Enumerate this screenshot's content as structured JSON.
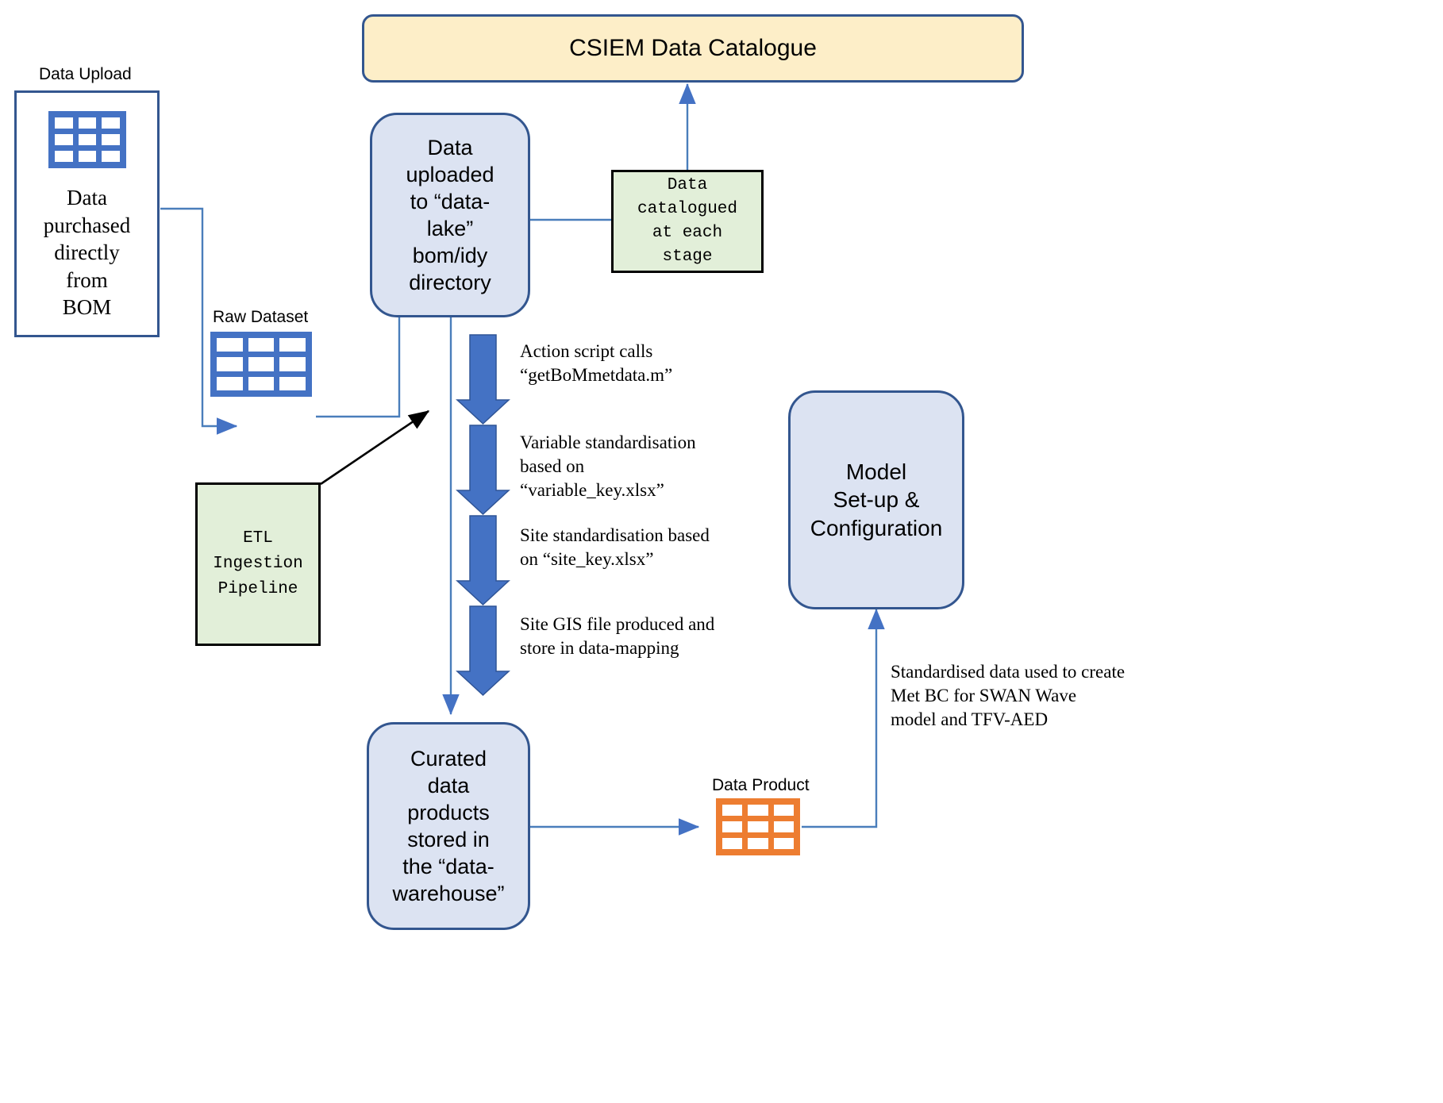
{
  "diagram": {
    "title_banner": {
      "label": "CSIEM Data Catalogue"
    },
    "nodes": {
      "data_upload_caption": "Data Upload",
      "data_upload_body": "Data\npurchased\ndirectly\nfrom\nBOM",
      "raw_dataset_caption": "Raw Dataset",
      "data_lake": "Data\nuploaded\nto “data-\nlake”\nbom/idy\ndirectory",
      "data_catalogued": "Data\ncatalogued\nat each\nstage",
      "etl_pipeline": "ETL\nIngestion\nPipeline",
      "model_setup": "Model\nSet-up &\nConfiguration",
      "curated_products": "Curated\ndata\nproducts\nstored in\nthe “data-\nwarehouse”",
      "data_product_caption": "Data Product"
    },
    "step_labels": [
      "Action script calls\n“getBoMmetdata.m”",
      "Variable standardisation\nbased on\n“variable_key.xlsx”",
      "Site standardisation based\non “site_key.xlsx”",
      "Site GIS file produced and\nstore in data-mapping"
    ],
    "annotations": {
      "model_input": "Standardised data used to create\nMet BC for SWAN Wave\nmodel and TFV-AED"
    },
    "colors": {
      "process_fill": "#dce3f2",
      "process_stroke": "#33568f",
      "banner_fill": "#fdeec8",
      "green_fill": "#e2efd9",
      "green_stroke": "#000000",
      "table_blue": "#4472c4",
      "table_orange": "#ed7d31",
      "arrow_blue": "#4472c4",
      "thick_arrow": "#4472c4",
      "connector": "#4a7ebb"
    }
  }
}
